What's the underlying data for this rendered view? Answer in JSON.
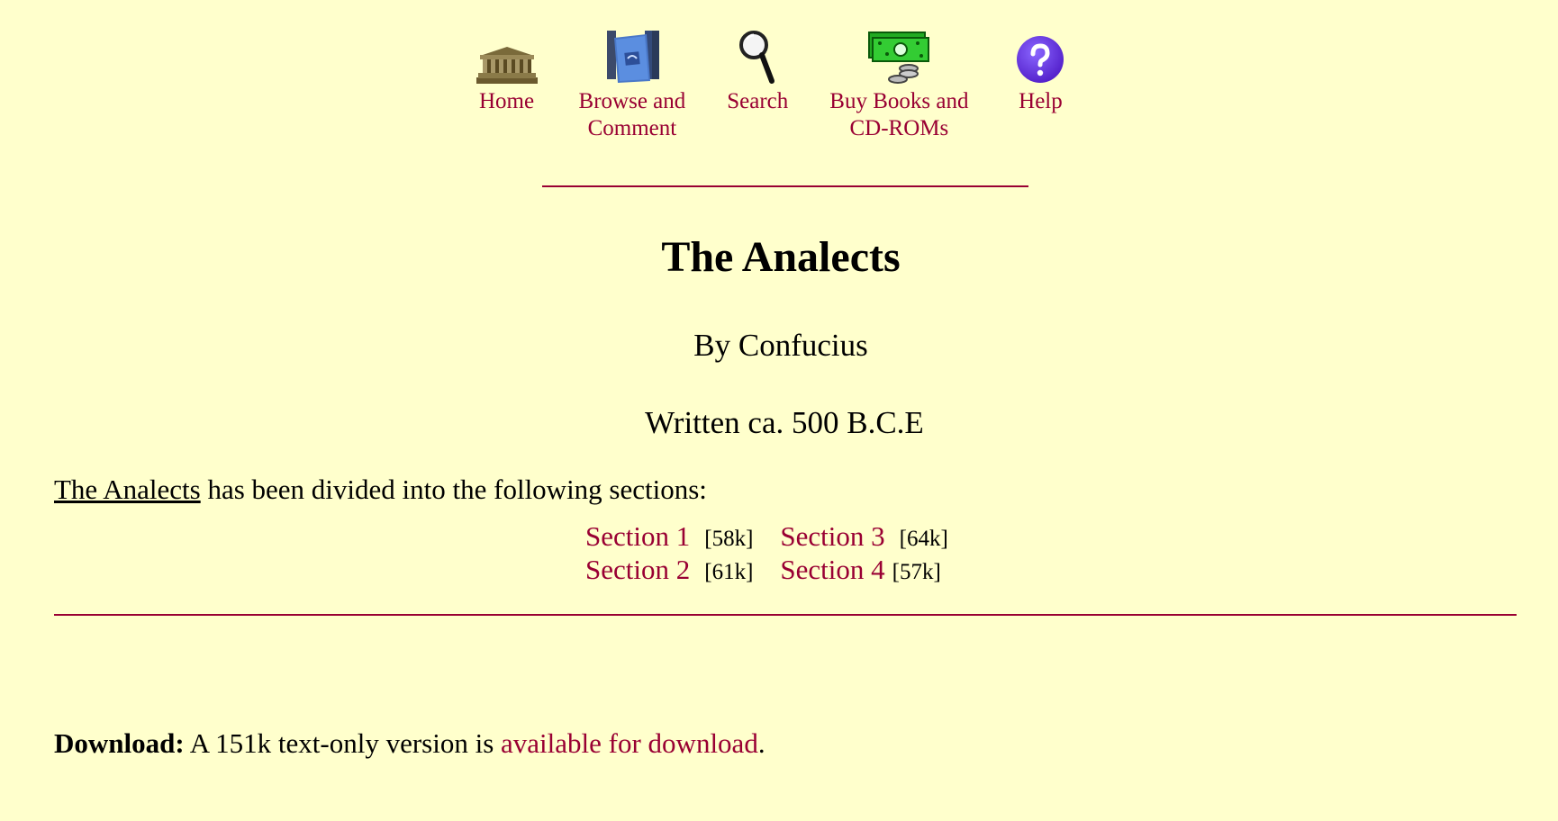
{
  "nav": {
    "items": [
      {
        "label": "Home",
        "icon": "parthenon-icon"
      },
      {
        "label": "Browse and\nComment",
        "icon": "books-icon"
      },
      {
        "label": "Search",
        "icon": "magnifier-icon"
      },
      {
        "label": "Buy Books and\nCD-ROMs",
        "icon": "money-icon"
      },
      {
        "label": "Help",
        "icon": "help-icon"
      }
    ]
  },
  "page": {
    "title": "The Analects",
    "author": "By Confucius",
    "written": "Written ca. 500 B.C.E",
    "intro_title": "The Analects",
    "intro_rest": " has been divided into the following sections:"
  },
  "sections": [
    {
      "label": "Section 1",
      "size": "[58k]"
    },
    {
      "label": "Section 2",
      "size": "[61k]"
    },
    {
      "label": "Section 3",
      "size": "[64k]"
    },
    {
      "label": "Section 4",
      "size": "[57k]"
    }
  ],
  "download": {
    "label": "Download:",
    "text": " A 151k text-only version is ",
    "link": "available for download",
    "end": "."
  },
  "colors": {
    "background": "#ffffcc",
    "link": "#990033"
  }
}
